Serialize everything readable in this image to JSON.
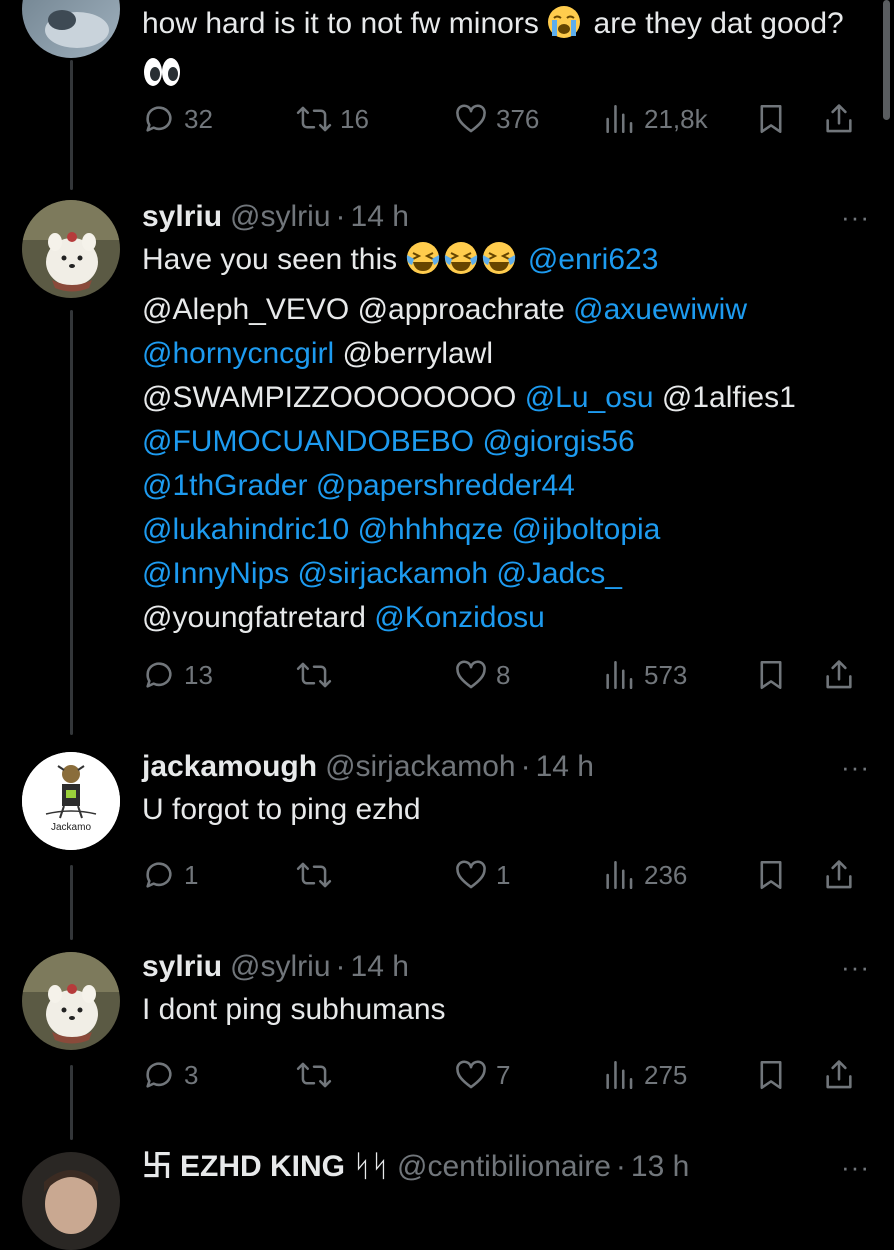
{
  "tweets": [
    {
      "body": "how hard is it to not fw minors",
      "body_mid": "are they dat good?",
      "emoji_1": "crying-face",
      "emoji_2": "eyes",
      "replies": "32",
      "retweets": "16",
      "likes": "376",
      "views": "21,8k"
    },
    {
      "name": "sylriu",
      "handle": "@sylriu",
      "dot": "·",
      "time": "14 h",
      "text": "Have you seen this",
      "emoji": "laughing-face",
      "mentions": [
        {
          "text": "@enri623",
          "link": true
        },
        {
          "text": "@Aleph_VEVO",
          "link": false
        },
        {
          "text": "@approachrate",
          "link": false
        },
        {
          "text": "@axuewiwiw",
          "link": true
        },
        {
          "text": "@hornycncgirl",
          "link": true
        },
        {
          "text": "@berrylawl",
          "link": false
        },
        {
          "text": "@SWAMPIZZOOOOOOOO",
          "link": false
        },
        {
          "text": "@Lu_osu",
          "link": true
        },
        {
          "text": "@1alfies1",
          "link": false
        },
        {
          "text": "@FUMOCUANDOBEBO",
          "link": true
        },
        {
          "text": "@giorgis56",
          "link": true
        },
        {
          "text": "@1thGrader",
          "link": true
        },
        {
          "text": "@papershredder44",
          "link": true
        },
        {
          "text": "@lukahindric10",
          "link": true
        },
        {
          "text": "@hhhhqze",
          "link": true
        },
        {
          "text": "@ijboltopia",
          "link": true
        },
        {
          "text": "@InnyNips",
          "link": true
        },
        {
          "text": "@sirjackamoh",
          "link": true
        },
        {
          "text": "@Jadcs_",
          "link": true
        },
        {
          "text": "@youngfatretard",
          "link": false
        },
        {
          "text": "@Konzidosu",
          "link": true
        }
      ],
      "replies": "13",
      "retweets": "",
      "likes": "8",
      "views": "573"
    },
    {
      "name": "jackamough",
      "handle": "@sirjackamoh",
      "dot": "·",
      "time": "14 h",
      "text": "U forgot to ping ezhd",
      "avatar_label": "Jackamo",
      "replies": "1",
      "retweets": "",
      "likes": "1",
      "views": "236"
    },
    {
      "name": "sylriu",
      "handle": "@sylriu",
      "dot": "·",
      "time": "14 h",
      "text": "I dont ping subhumans",
      "replies": "3",
      "retweets": "",
      "likes": "7",
      "views": "275"
    },
    {
      "name_prefix": "卐",
      "name": "EZHD KING",
      "name_suffix": "ᛋᛋ",
      "handle": "@centibilionaire",
      "dot": "·",
      "time": "13 h"
    }
  ],
  "icons": {
    "more": "···",
    "reply": "reply-icon",
    "retweet": "retweet-icon",
    "like": "heart-icon",
    "views": "views-icon",
    "bookmark": "bookmark-icon",
    "share": "share-icon"
  },
  "colors": {
    "background": "#000000",
    "text": "#e7e9ea",
    "muted": "#71767b",
    "link": "#1d9bf0",
    "thread_line": "#333639"
  }
}
